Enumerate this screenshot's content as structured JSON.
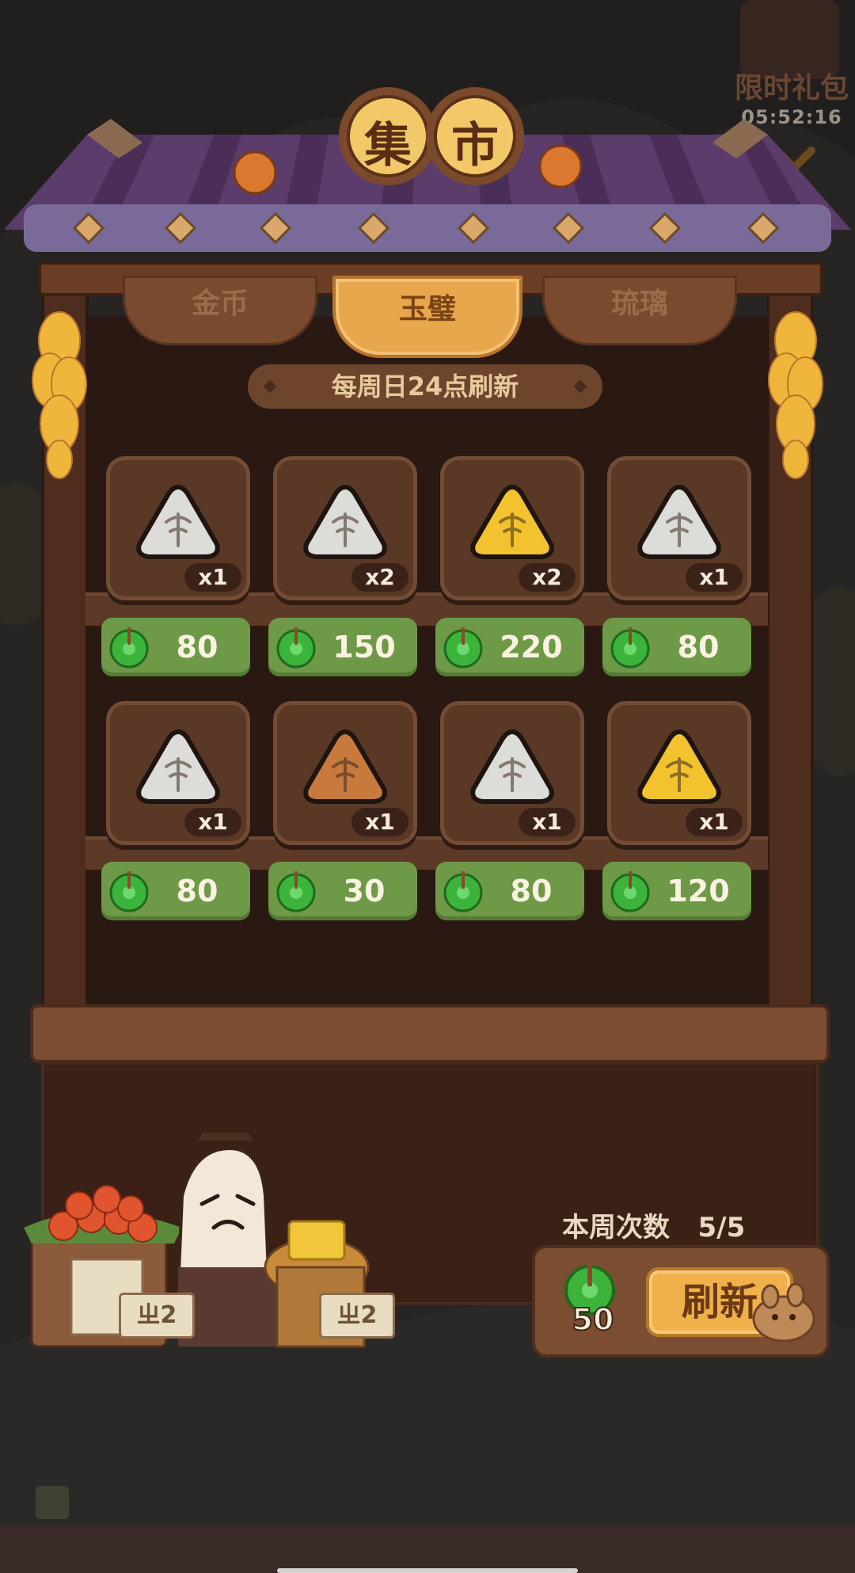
{
  "header": {
    "title_chars": [
      "集",
      "市"
    ]
  },
  "limited_gift": {
    "label": "限时礼包",
    "timer": "05:52:16"
  },
  "tabs": [
    {
      "label": "金币",
      "active": false
    },
    {
      "label": "玉璧",
      "active": true
    },
    {
      "label": "琉璃",
      "active": false
    }
  ],
  "refresh_notice": "每周日24点刷新",
  "items": [
    {
      "qty": "x1",
      "price": "80",
      "color": "#dcdcd8",
      "icon": "silver-stone-icon"
    },
    {
      "qty": "x2",
      "price": "150",
      "color": "#dcdcd8",
      "icon": "silver-stone-icon"
    },
    {
      "qty": "x2",
      "price": "220",
      "color": "#f2c32e",
      "icon": "gold-stone-icon"
    },
    {
      "qty": "x1",
      "price": "80",
      "color": "#dcdcd8",
      "icon": "silver-stone-icon"
    },
    {
      "qty": "x1",
      "price": "80",
      "color": "#dcdcd8",
      "icon": "silver-stone-icon"
    },
    {
      "qty": "x1",
      "price": "30",
      "color": "#c77a3c",
      "icon": "bronze-stone-icon"
    },
    {
      "qty": "x1",
      "price": "80",
      "color": "#dcdcd8",
      "icon": "silver-stone-icon"
    },
    {
      "qty": "x1",
      "price": "120",
      "color": "#f2c32e",
      "icon": "gold-stone-icon"
    }
  ],
  "weekly": {
    "label": "本周次数",
    "value": "5/5"
  },
  "refresh": {
    "cost": "50",
    "label": "刷新"
  },
  "vendor_signs": [
    "ㄓ2",
    "ㄓ2"
  ],
  "colors": {
    "jade": "#3cb43c",
    "price_bg": "#6e9a48",
    "tab_active": "#e8a74c",
    "roof": "#5b3c6a"
  }
}
